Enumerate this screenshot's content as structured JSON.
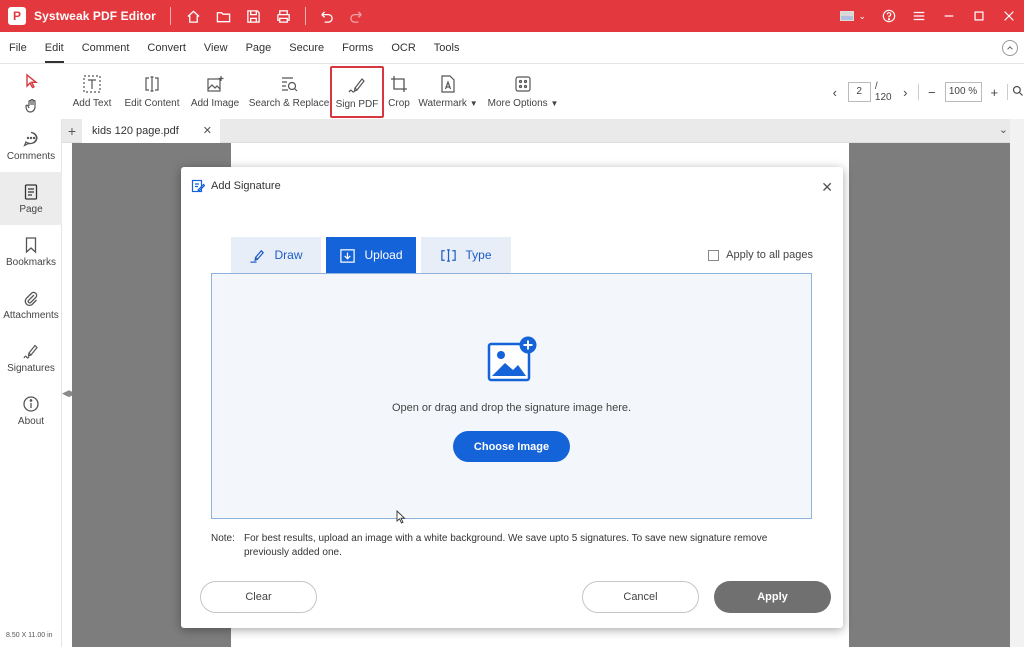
{
  "titlebar": {
    "app_title": "Systweak PDF Editor",
    "quick_actions": [
      "home-icon",
      "folder-icon",
      "save-icon",
      "print-icon",
      "undo-icon",
      "redo-icon"
    ],
    "right_icons": [
      "flag-us-icon",
      "help-icon",
      "menu-icon",
      "minimize-icon",
      "maximize-icon",
      "close-icon"
    ]
  },
  "menubar": {
    "items": [
      "File",
      "Edit",
      "Comment",
      "Convert",
      "View",
      "Page",
      "Secure",
      "Forms",
      "OCR",
      "Tools"
    ],
    "active": "Edit"
  },
  "toolbar": {
    "tools": [
      {
        "label": "Add Text",
        "icon": "add-text-icon"
      },
      {
        "label": "Edit Content",
        "icon": "edit-content-icon"
      },
      {
        "label": "Add Image",
        "icon": "add-image-icon"
      },
      {
        "label": "Search & Replace",
        "icon": "search-replace-icon"
      },
      {
        "label": "Sign PDF",
        "icon": "sign-pdf-icon",
        "highlighted": true
      },
      {
        "label": "Crop",
        "icon": "crop-icon"
      },
      {
        "label": "Watermark",
        "icon": "watermark-icon",
        "dropdown": true
      },
      {
        "label": "More Options",
        "icon": "more-options-icon",
        "dropdown": true
      }
    ],
    "page_current": "2",
    "page_total": "/ 120",
    "zoom": "100 %"
  },
  "sidebar": {
    "items": [
      {
        "label": "Comments",
        "icon": "comments-icon"
      },
      {
        "label": "Page",
        "icon": "page-icon",
        "active": true
      },
      {
        "label": "Bookmarks",
        "icon": "bookmark-icon"
      },
      {
        "label": "Attachments",
        "icon": "attachment-icon"
      },
      {
        "label": "Signatures",
        "icon": "signature-icon"
      },
      {
        "label": "About",
        "icon": "info-icon"
      }
    ],
    "page_size": "8.50 X 11.00 in"
  },
  "tabs": {
    "documents": [
      {
        "name": "kids 120 page.pdf"
      }
    ]
  },
  "dialog": {
    "title": "Add Signature",
    "tabs": [
      {
        "label": "Draw",
        "icon": "draw-pen-icon"
      },
      {
        "label": "Upload",
        "icon": "upload-icon",
        "active": true
      },
      {
        "label": "Type",
        "icon": "type-cursor-icon"
      }
    ],
    "apply_all_label": "Apply to all pages",
    "dropzone_text": "Open or drag and drop the signature image here.",
    "choose_button": "Choose Image",
    "note_label": "Note:",
    "note_text": "For best results, upload an image with a white background. We save upto 5 signatures. To save new signature remove previously added one.",
    "clear_button": "Clear",
    "cancel_button": "Cancel",
    "apply_button": "Apply"
  },
  "colors": {
    "brand": "#e3383e",
    "accent_blue": "#1463d8",
    "apply_disabled": "#707070"
  }
}
